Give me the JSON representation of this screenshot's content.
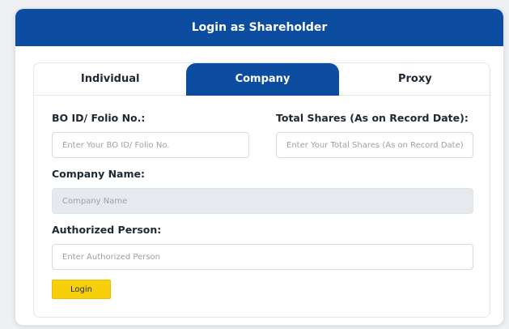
{
  "header": {
    "title": "Login as Shareholder"
  },
  "tabs": [
    {
      "label": "Individual",
      "active": false
    },
    {
      "label": "Company",
      "active": true
    },
    {
      "label": "Proxy",
      "active": false
    }
  ],
  "form": {
    "bo_id": {
      "label": "BO ID/ Folio No.:",
      "placeholder": "Enter Your BO ID/ Folio No."
    },
    "total_shares": {
      "label": "Total Shares (As on Record Date):",
      "placeholder": "Enter Your Total Shares (As on Record Date)"
    },
    "company_name": {
      "label": "Company Name:",
      "placeholder": "Company Name"
    },
    "authorized_person": {
      "label": "Authorized Person:",
      "placeholder": "Enter Authorized Person"
    },
    "login_label": "Login"
  },
  "colors": {
    "primary": "#0c4da2",
    "button": "#f7cf0a"
  }
}
